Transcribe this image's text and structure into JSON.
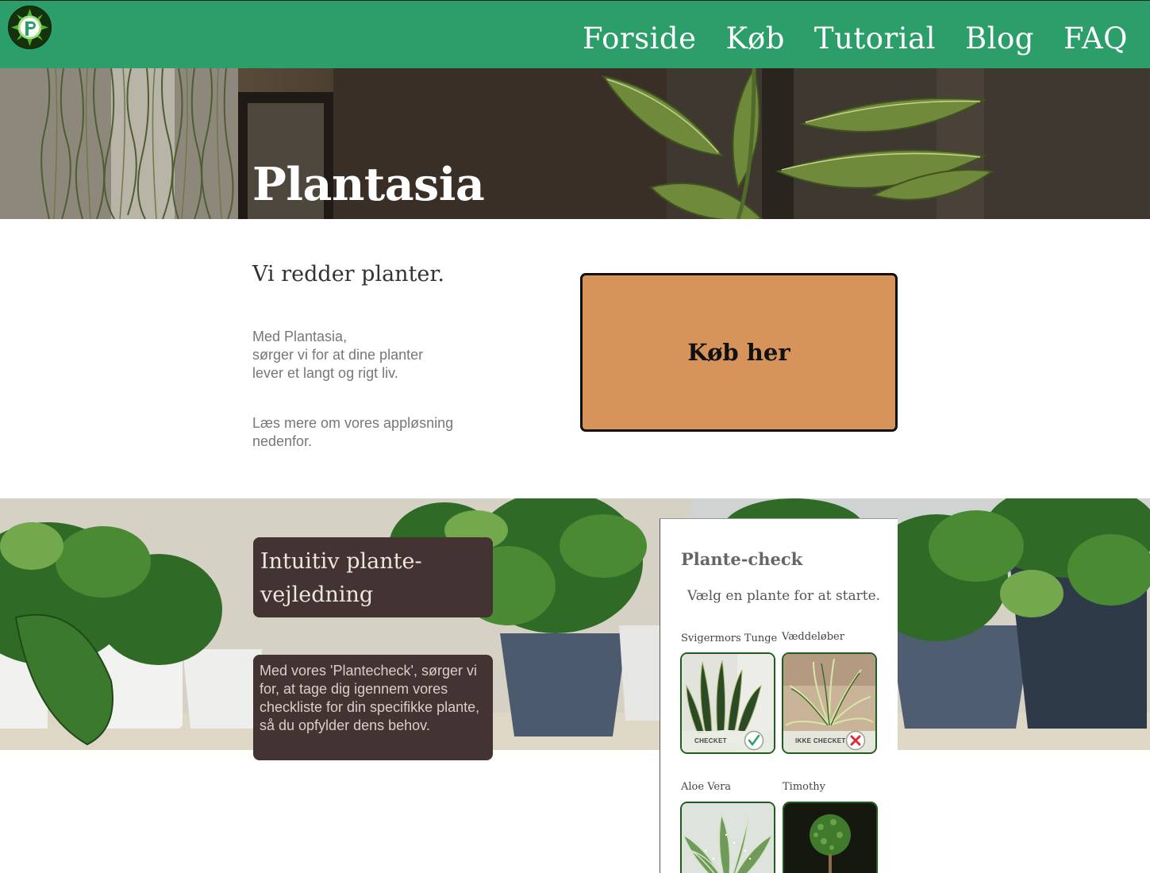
{
  "nav": {
    "items": [
      {
        "label": "Forside"
      },
      {
        "label": "Køb"
      },
      {
        "label": "Tutorial"
      },
      {
        "label": "Blog"
      },
      {
        "label": "FAQ"
      }
    ],
    "logo_letter": "P",
    "background": "#2c9e6a"
  },
  "hero": {
    "title": "Plantasia"
  },
  "intro": {
    "tagline": "Vi redder planter.",
    "paragraph": "Med Plantasia,\nsørger vi for at dine planter\nlever et langt og rigt liv.",
    "more": "Læs mere om vores appløsning nedenfor.",
    "buy_button": "Køb her",
    "buy_button_color": "#d7945a"
  },
  "feature": {
    "heading": "Intuitiv plante-vejledning",
    "text": "Med vores 'Plantecheck', sørger vi for, at tage dig igennem vores checkliste for din specifikke plante, så du opfylder dens behov.",
    "box_color": "#433333"
  },
  "plant_check": {
    "title": "Plante-check",
    "subtitle": "Vælg en plante for at starte.",
    "plants": [
      {
        "name": "Svigermors Tunge",
        "status": "CHECKET",
        "icon": "checkmark-icon"
      },
      {
        "name": "Væddeløber",
        "status": "IKKE CHECKET",
        "icon": "cross-icon"
      },
      {
        "name": "Aloe Vera"
      },
      {
        "name": "Timothy"
      }
    ]
  }
}
